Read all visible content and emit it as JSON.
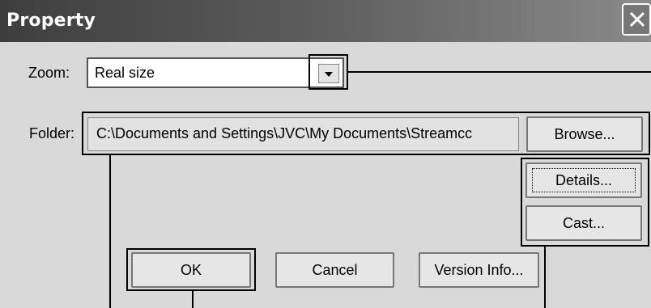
{
  "dialog": {
    "title": "Property",
    "close_icon": "close-x-icon"
  },
  "zoom": {
    "label": "Zoom:",
    "value": "Real size",
    "dropdown_icon": "chevron-down-icon"
  },
  "folder": {
    "label": "Folder:",
    "path": "C:\\Documents and Settings\\JVC\\My Documents\\Streamcc"
  },
  "buttons": {
    "browse": "Browse...",
    "details": "Details...",
    "cast": "Cast...",
    "ok": "OK",
    "cancel": "Cancel",
    "version_info": "Version Info..."
  },
  "colors": {
    "titlebar": "#3e3e3e",
    "dialog_bg": "#d9d9d9",
    "callout": "#000000"
  }
}
